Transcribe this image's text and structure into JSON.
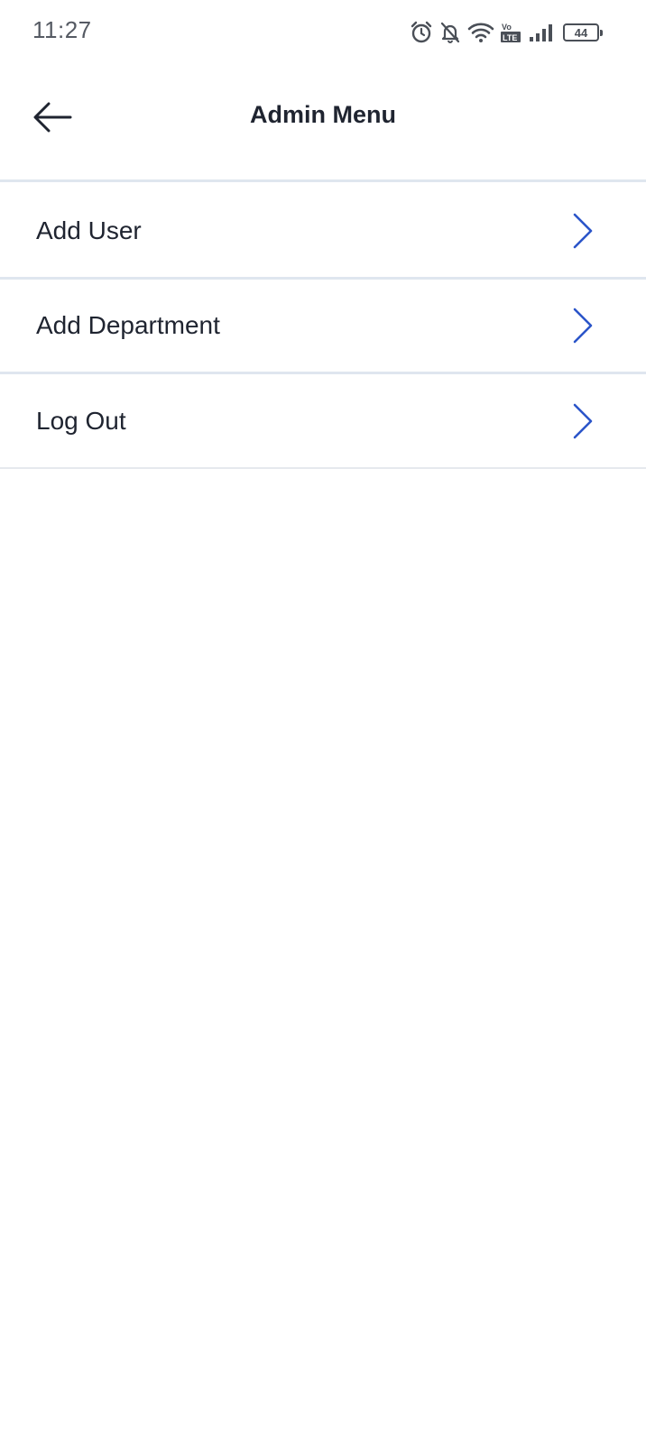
{
  "status_bar": {
    "time": "11:27",
    "battery_level": "44",
    "icons": [
      "alarm-icon",
      "bell-off-icon",
      "wifi-icon",
      "volte-icon",
      "signal-icon",
      "battery-icon"
    ]
  },
  "header": {
    "title": "Admin Menu",
    "back_icon": "arrow-left-icon"
  },
  "menu": {
    "items": [
      {
        "label": "Add User",
        "icon": "chevron-right-icon"
      },
      {
        "label": "Add Department",
        "icon": "chevron-right-icon"
      },
      {
        "label": "Log Out",
        "icon": "chevron-right-icon"
      }
    ]
  },
  "colors": {
    "accent": "#2b55c9",
    "divider": "#dfe6ef",
    "text": "#1f2430",
    "status_text": "#555a63"
  }
}
